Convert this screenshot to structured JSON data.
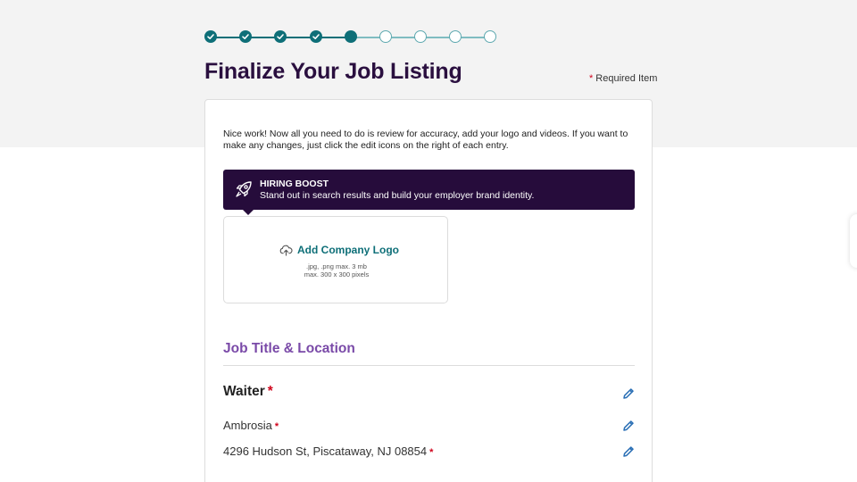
{
  "progress": {
    "completed_steps": 4,
    "current_step": 5,
    "total_steps": 9
  },
  "header": {
    "title": "Finalize Your Job Listing",
    "required_star": "*",
    "required_label": "Required Item"
  },
  "card": {
    "intro": "Nice work! Now all you need to do is review for accuracy, add your logo and videos. If you want to make any changes, just click the edit icons on the right of each entry.",
    "boost": {
      "icon": "rocket-icon",
      "title": "HIRING BOOST",
      "subtitle": "Stand out in search results and build your employer brand identity."
    },
    "logo_upload": {
      "icon": "cloud-upload-icon",
      "label": "Add Company Logo",
      "formats": ".jpg, .png   max. 3 mb",
      "dimensions": "max. 300 x 300 pixels"
    },
    "section": {
      "title": "Job Title & Location",
      "job_title": "Waiter",
      "company": "Ambrosia",
      "address": "4296 Hudson St, Piscataway, NJ 08854",
      "required_star": "*"
    }
  },
  "colors": {
    "accent": "#0e6f78",
    "brand_dark": "#260c3b",
    "section_purple": "#7a4aa8",
    "required_red": "#d0021b",
    "edit_blue": "#2a6fb5"
  }
}
